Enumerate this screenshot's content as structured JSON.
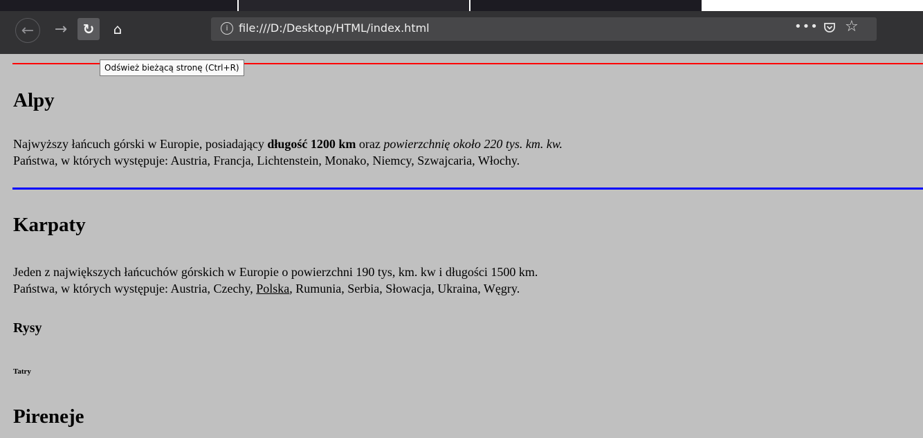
{
  "browser": {
    "url": "file:///D:/Desktop/HTML/index.html",
    "tooltip": "Odśwież bieżącą stronę (Ctrl+R)",
    "icons": [
      "back-arrow-icon",
      "forward-arrow-icon",
      "reload-icon",
      "home-icon",
      "info-icon",
      "more-actions-icon",
      "pocket-icon",
      "bookmark-star-icon"
    ]
  },
  "colors": {
    "page_bg": "#c0c0c0",
    "hr_top": "#ff0000",
    "hr_middle": "#0000ff",
    "toolbar_bg": "#323234"
  },
  "sections": {
    "alpy": {
      "title": "Alpy",
      "line1_a": "Najwyższy łańcuch górski w Europie, posiadający ",
      "line1_bold": "długość 1200 km",
      "line1_b": " oraz ",
      "line1_italic": "powierzchnię około 220 tys. km. kw.",
      "line2": "Państwa, w których występuje: Austria, Francja, Lichtenstein, Monako, Niemcy, Szwajcaria, Włochy."
    },
    "karpaty": {
      "title": "Karpaty",
      "line1": "Jeden z największych łańcuchów górskich w Europie o powierzchni 190 tys, km. kw i długości 1500 km.",
      "line2_a": "Państwa, w których występuje: Austria, Czechy, ",
      "line2_u": "Polska",
      "line2_b": ", Rumunia, Serbia, Słowacja, Ukraina, Węgry."
    },
    "rysy": {
      "title": "Rysy",
      "subtitle": "Tatry"
    },
    "pireneje": {
      "title": "Pireneje"
    }
  }
}
